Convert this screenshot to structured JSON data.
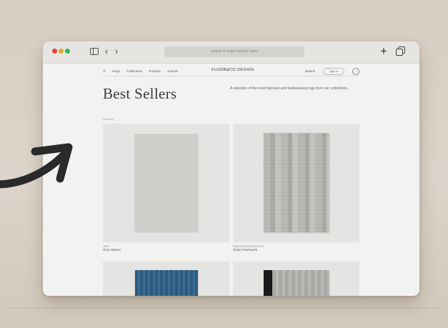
{
  "browser": {
    "address_text": "search or enter website name",
    "plus_label": "+",
    "back_label": "‹",
    "forward_label": "›"
  },
  "site": {
    "brand": "FLOOR&CO DESIGN",
    "nav": [
      "Rugs",
      "Collections",
      "Projects",
      "Journal"
    ],
    "signin": "Search",
    "cart_label": "Sign In",
    "heading": "Best Sellers",
    "intro": "A selection of the most beloved and hardwearing rugs from our collections.",
    "count": "Showing"
  },
  "products": [
    {
      "meta": "NEW",
      "name": "Grey Weave"
    },
    {
      "meta": "HANDWOVEN WOOL RUG",
      "name": "Stripe Patchwork"
    }
  ],
  "icons": {
    "sidebar": "sidebar-toggle-icon",
    "tabs": "tab-overview-icon",
    "arrow": "curved-arrow-icon"
  },
  "colors": {
    "backdrop": "#d9d1c6",
    "window": "#f1f1ef",
    "traffic_red": "#e5463d",
    "traffic_yellow": "#e3a72d",
    "traffic_green": "#35b44a",
    "arrow": "#2a2a2a"
  }
}
